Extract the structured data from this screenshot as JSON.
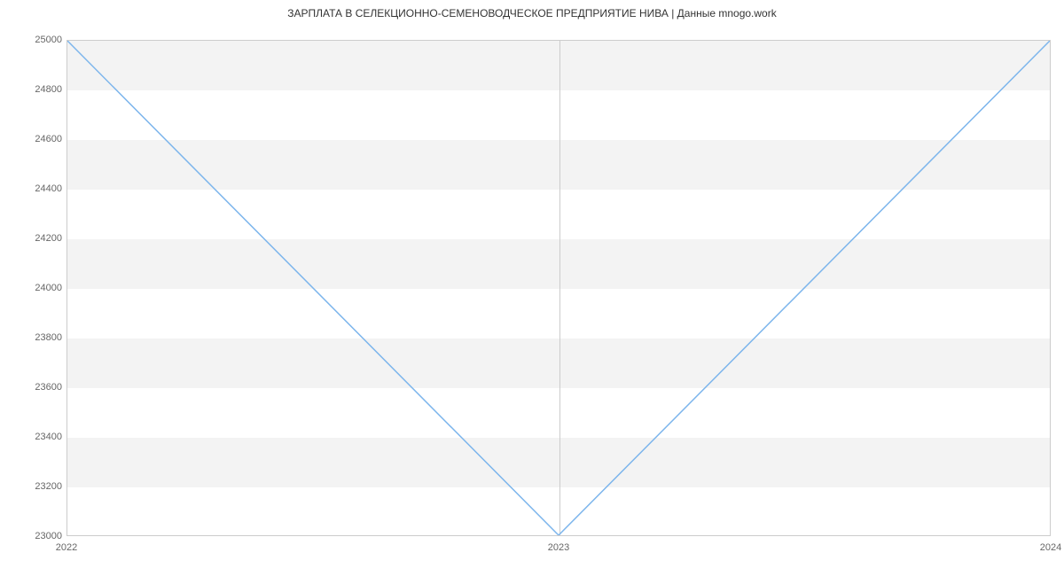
{
  "chart_data": {
    "type": "line",
    "title": "ЗАРПЛАТА В  СЕЛЕКЦИОННО-СЕМЕНОВОДЧЕСКОЕ ПРЕДПРИЯТИЕ НИВА | Данные mnogo.work",
    "x": [
      2022,
      2023,
      2024
    ],
    "values": [
      25000,
      23000,
      25000
    ],
    "x_ticks": [
      "2022",
      "2023",
      "2024"
    ],
    "y_ticks": [
      23000,
      23200,
      23400,
      23600,
      23800,
      24000,
      24200,
      24400,
      24600,
      24800,
      25000
    ],
    "ylim": [
      23000,
      25000
    ],
    "xlim": [
      2022,
      2024
    ],
    "xlabel": "",
    "ylabel": "",
    "line_color": "#7cb5ec",
    "band_color": "#f3f3f3"
  }
}
